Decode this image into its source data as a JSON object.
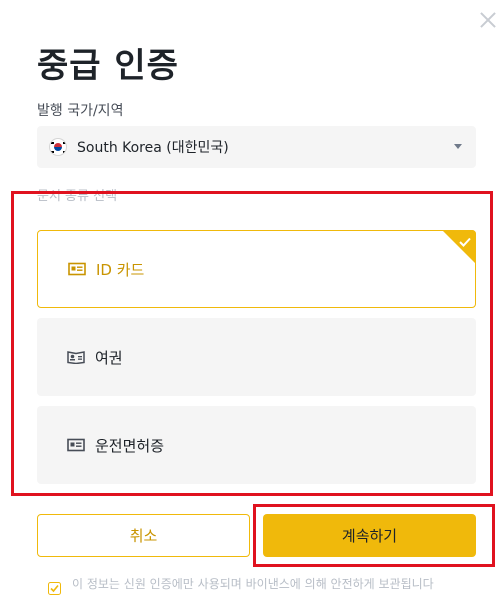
{
  "dialog": {
    "title": "중급 인증"
  },
  "country": {
    "label": "발행 국가/지역",
    "selected_value": "South Korea (대한민국)",
    "flag_icon": "south-korea-flag-icon"
  },
  "document_type": {
    "label": "문서 종류 선택",
    "options": [
      {
        "label": "ID 카드",
        "icon": "id-card-icon",
        "selected": true
      },
      {
        "label": "여권",
        "icon": "passport-icon",
        "selected": false
      },
      {
        "label": "운전면허증",
        "icon": "drivers-license-icon",
        "selected": false
      }
    ]
  },
  "buttons": {
    "cancel_label": "취소",
    "continue_label": "계속하기"
  },
  "notice": {
    "text": "이 정보는 신원 인증에만 사용되며 바이낸스에 의해 안전하게 보관됩니다"
  },
  "colors": {
    "accent": "#F0B90B",
    "highlight_box": "#E0121F",
    "selected_text": "#C99400"
  }
}
